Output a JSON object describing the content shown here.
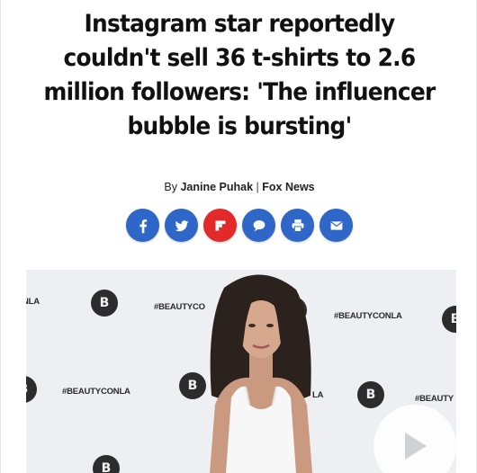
{
  "article": {
    "headline": "Instagram star reportedly couldn't sell 36 t-shirts to 2.6 million followers: 'The influencer bubble is bursting'",
    "byline": {
      "by": "By",
      "author": "Janine Puhak",
      "separator": "|",
      "outlet": "Fox News"
    }
  },
  "share": {
    "buttons": [
      {
        "name": "facebook-icon",
        "color": "#2f67c8"
      },
      {
        "name": "twitter-icon",
        "color": "#2f67c8"
      },
      {
        "name": "flipboard-icon",
        "color": "#e32a2a"
      },
      {
        "name": "comment-icon",
        "color": "#2f67c8"
      },
      {
        "name": "print-icon",
        "color": "#2f67c8"
      },
      {
        "name": "email-icon",
        "color": "#2f67c8"
      }
    ]
  },
  "photo": {
    "backdrop_texts": [
      "NLA",
      "#BEAUTYCO",
      "#BEAUTYCONLA",
      "#BEAUTYCONLA",
      "LA",
      "#BEAUTY"
    ],
    "logo_letter": "B"
  },
  "video": {
    "play_icon": "play-icon"
  }
}
